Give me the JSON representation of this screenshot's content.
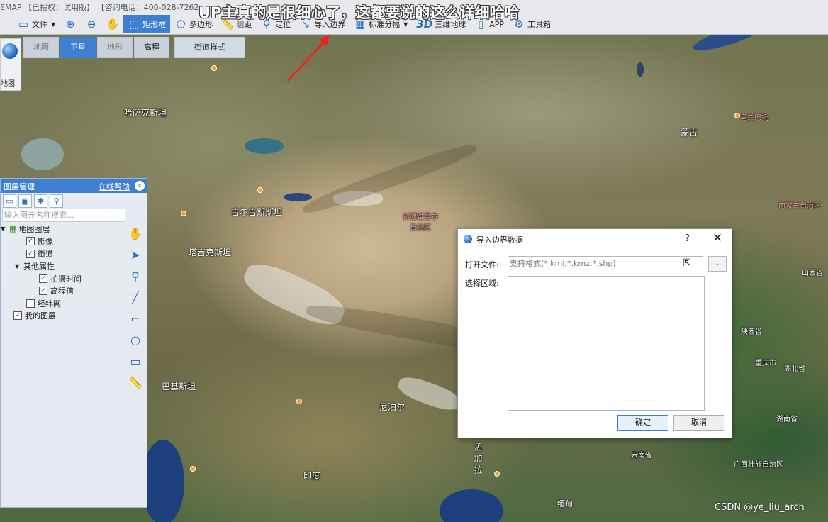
{
  "app": {
    "title": "EMAP 【已授权：试用版】 【咨询电话：400-028-7262",
    "caption": "UP主真的是很细心了，这都要说的这么详细哈哈"
  },
  "toolbar": {
    "file": "文件",
    "rect": "矩形框",
    "polygon": "多边形",
    "measure": "测距",
    "locate": "定位",
    "import_boundary": "导入边界",
    "standard_sheet": "标准分幅",
    "globe3d_badge": "3D",
    "globe3d": "三维地球",
    "app": "APP",
    "toolbox": "工具箱"
  },
  "map_tabs": {
    "map": "地图",
    "satellite": "卫星",
    "terrain": "地形",
    "elevation": "高程",
    "street_style": "街道样式"
  },
  "globe_button": {
    "label": "地图"
  },
  "layer_panel": {
    "title": "图层管理",
    "help": "在线帮助",
    "search_placeholder": "输入图元名称搜索...",
    "tree": {
      "map_layers": "地图图层",
      "imagery": "影像",
      "streets": "街道",
      "other_attributes": "其他属性",
      "capture_time": "拍摄时间",
      "elevation_value": "高程值",
      "graticule": "经纬网",
      "my_layers": "我的图层"
    }
  },
  "dialog": {
    "title": "导入边界数据",
    "help": "?",
    "close": "✕",
    "open_file_label": "打开文件:",
    "file_placeholder": "支持格式(*.kml;*.kmz;*.shp)",
    "browse": "...",
    "select_region_label": "选择区域:",
    "ok": "确定",
    "cancel": "取消"
  },
  "map_labels": {
    "kazakhstan": "哈萨克斯坦",
    "kyrgyzstan": "吉尔吉斯斯坦",
    "tajikistan": "塔吉克斯坦",
    "mongolia": "蒙古",
    "pakistan": "巴基斯坦",
    "nepal": "尼泊尔",
    "india": "印度",
    "bangladesh": "孟加拉",
    "shaanxi": "陕西省",
    "hubei": "湖北省",
    "hunan": "湖南省",
    "yunnan": "云南省",
    "chongqing": "重庆市",
    "shanxi": "山西省",
    "guangxi": "广西壮族自治区",
    "xinjiang": "新疆维吾尔自治区",
    "inner_mongolia": "内蒙古自治区",
    "burma": "缅甸",
    "ulaanbaatar": "乌兰巴托"
  },
  "watermark": "CSDN @ye_liu_arch",
  "colors": {
    "accent": "#3f7fd1",
    "arrow": "#e8281e"
  }
}
